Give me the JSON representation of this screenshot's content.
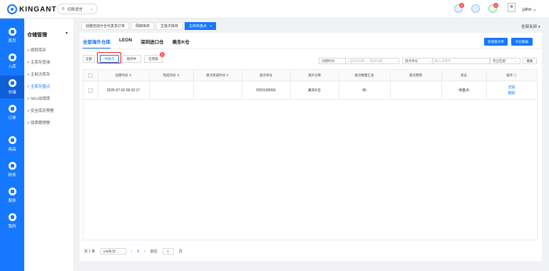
{
  "brand": {
    "logo_text": "KINGANT"
  },
  "topbar": {
    "language_label": "切换语言",
    "notif_badge_1": "4",
    "notif_badge_2": "4",
    "username": "john"
  },
  "sidebar": {
    "items": [
      {
        "label": "首页"
      },
      {
        "label": "入库"
      },
      {
        "label": "仓储"
      },
      {
        "label": "订单"
      },
      {
        "label": "商品"
      },
      {
        "label": "财务"
      },
      {
        "label": "服务"
      },
      {
        "label": "我的"
      }
    ]
  },
  "submenu": {
    "title": "仓储管理",
    "items": [
      {
        "label": "> 周转库存"
      },
      {
        "label": "> 主库存查询"
      },
      {
        "label": "> 主批次库存"
      },
      {
        "label": "> 主库存盘点"
      },
      {
        "label": "> SKU动销率"
      },
      {
        "label": "> 安全库存预警"
      },
      {
        "label": "> 保质期预警"
      }
    ]
  },
  "page_tabs": {
    "items": [
      {
        "label": "创建自动分仓代发货订单"
      },
      {
        "label": "周转库存"
      },
      {
        "label": "主批次库存"
      },
      {
        "label": "主库存盘点",
        "close": "×"
      }
    ],
    "close_all": "全部关闭"
  },
  "warehouse_tabs": [
    "全部海外仓库",
    "LEON",
    "深圳进口仓",
    "美东K仓"
  ],
  "actions": {
    "new_count": "新增盘点单",
    "export": "导出数据"
  },
  "status_buttons": [
    {
      "label": "全部"
    },
    {
      "label": "待盘点"
    },
    {
      "label": "盘点中"
    },
    {
      "label": "已完成"
    }
  ],
  "status_badge": "6",
  "filters": {
    "time_type": "创建时间",
    "start_date": "开始日期",
    "to": "→",
    "end_date": "结束日期",
    "field": "盘点单号",
    "keyword_placeholder": "输入关键字",
    "match": "完全匹配",
    "search": "搜索"
  },
  "table": {
    "headers": [
      "创建时间",
      "完成时间",
      "盘点完成时间",
      "盘点单号",
      "海外仓库",
      "盘点数量汇总",
      "盘点费用",
      "状态",
      "操作"
    ],
    "rows": [
      {
        "created": "2025-07-02 09:32:17",
        "finished": "",
        "count_finished": "",
        "order_no": "PDD100056",
        "warehouse": "美东K仓",
        "qty_total": "86",
        "fee": "",
        "status": "待盘点",
        "actions": [
          "详情",
          "删除"
        ]
      }
    ]
  },
  "pagination": {
    "total": "共 1 条",
    "page_size": "100条/页",
    "prev": "‹",
    "current": "1",
    "next": "›",
    "goto_label": "前往",
    "goto_value": "1",
    "page_suffix": "页"
  },
  "colors": {
    "primary": "#1677ff",
    "highlight_box": "#e5201b"
  }
}
